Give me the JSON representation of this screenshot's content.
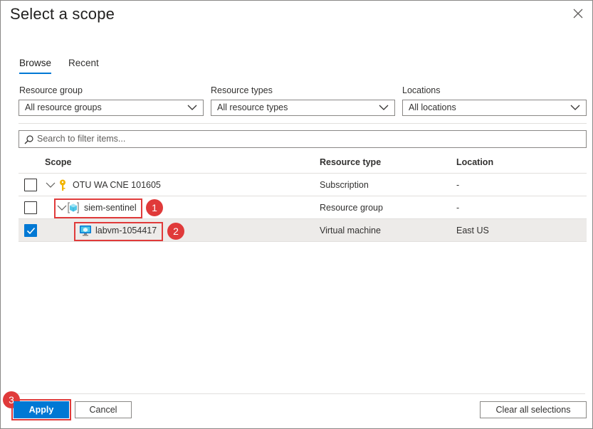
{
  "dialog": {
    "title": "Select a scope"
  },
  "tabs": [
    {
      "label": "Browse",
      "active": true
    },
    {
      "label": "Recent",
      "active": false
    }
  ],
  "filters": {
    "resource_group": {
      "label": "Resource group",
      "value": "All resource groups"
    },
    "resource_types": {
      "label": "Resource types",
      "value": "All resource types"
    },
    "locations": {
      "label": "Locations",
      "value": "All locations"
    }
  },
  "search": {
    "placeholder": "Search to filter items..."
  },
  "grid": {
    "columns": [
      "Scope",
      "Resource type",
      "Location"
    ],
    "rows": [
      {
        "scope": "OTU WA CNE 101605",
        "type": "Subscription",
        "location": "-",
        "checked": false,
        "icon": "key-icon"
      },
      {
        "scope": "siem-sentinel",
        "type": "Resource group",
        "location": "-",
        "checked": false,
        "icon": "resource-group-icon"
      },
      {
        "scope": "labvm-1054417",
        "type": "Virtual machine",
        "location": "East US",
        "checked": true,
        "icon": "virtual-machine-icon"
      }
    ]
  },
  "annotations": {
    "step1": "1",
    "step2": "2",
    "step3": "3",
    "color": "#e03a3a"
  },
  "footer": {
    "apply_label": "Apply",
    "cancel_label": "Cancel",
    "clear_label": "Clear all selections"
  },
  "colors": {
    "accent": "#0078d4",
    "selected_row": "#edebe9",
    "key": "#f2b400"
  }
}
